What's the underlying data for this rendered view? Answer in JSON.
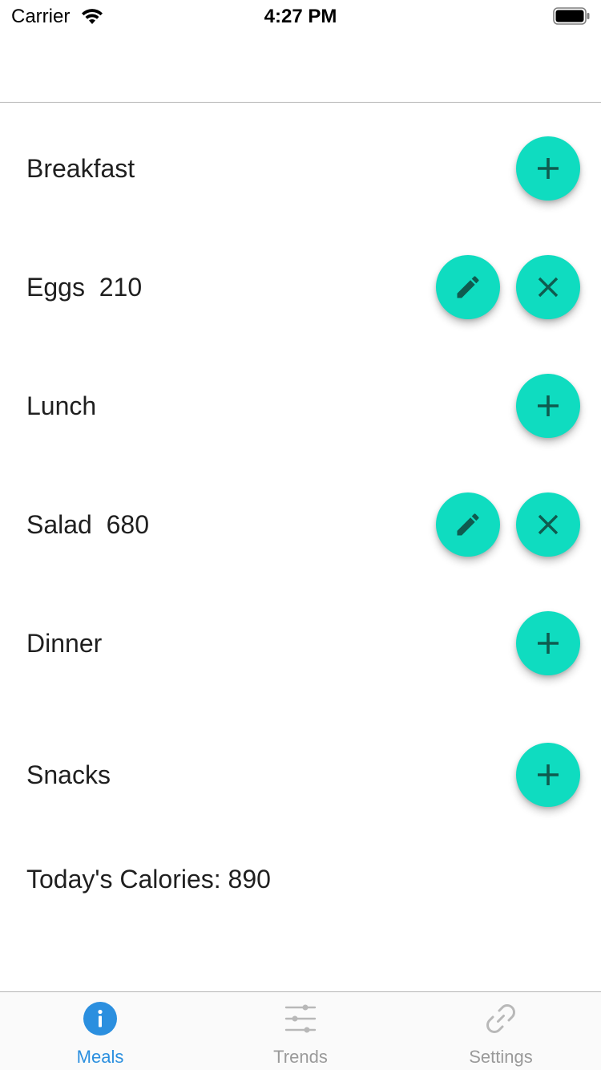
{
  "status_bar": {
    "carrier": "Carrier",
    "time": "4:27 PM"
  },
  "colors": {
    "accent": "#0fdcc0",
    "icon_dark": "#0f5b4f",
    "tab_active": "#2b8fdf",
    "tab_inactive": "#9a9a9a"
  },
  "meals": {
    "breakfast": {
      "label": "Breakfast",
      "action_icon": "plus-icon"
    },
    "eggs": {
      "label": "Eggs  210",
      "actions": [
        "pencil-icon",
        "close-icon"
      ]
    },
    "lunch": {
      "label": "Lunch",
      "action_icon": "plus-icon"
    },
    "salad": {
      "label": "Salad  680",
      "actions": [
        "pencil-icon",
        "close-icon"
      ]
    },
    "dinner": {
      "label": "Dinner",
      "action_icon": "plus-icon"
    },
    "snacks": {
      "label": "Snacks",
      "action_icon": "plus-icon"
    }
  },
  "summary": {
    "label": "Today's Calories:",
    "value": "890"
  },
  "tab_bar": {
    "tabs": [
      {
        "label": "Meals",
        "icon": "info-icon",
        "active": true
      },
      {
        "label": "Trends",
        "icon": "sliders-icon",
        "active": false
      },
      {
        "label": "Settings",
        "icon": "link-icon",
        "active": false
      }
    ]
  }
}
